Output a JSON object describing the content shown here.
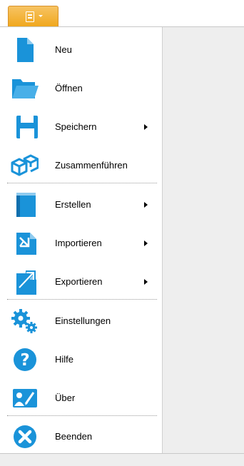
{
  "colors": {
    "accent": "#1a93d9",
    "app_button": "#f0a81d",
    "content_bg": "#eeeeee"
  },
  "menu": {
    "items": [
      {
        "label": "Neu",
        "icon": "new-document-icon",
        "submenu": false
      },
      {
        "label": "Öffnen",
        "icon": "folder-open-icon",
        "submenu": false
      },
      {
        "label": "Speichern",
        "icon": "save-icon",
        "submenu": true
      },
      {
        "label": "Zusammenführen",
        "icon": "merge-cubes-icon",
        "submenu": false
      },
      {
        "label": "Erstellen",
        "icon": "book-icon",
        "submenu": true
      },
      {
        "label": "Importieren",
        "icon": "import-icon",
        "submenu": true
      },
      {
        "label": "Exportieren",
        "icon": "export-icon",
        "submenu": true
      },
      {
        "label": "Einstellungen",
        "icon": "gears-icon",
        "submenu": false
      },
      {
        "label": "Hilfe",
        "icon": "help-icon",
        "submenu": false
      },
      {
        "label": "Über",
        "icon": "about-icon",
        "submenu": false
      },
      {
        "label": "Beenden",
        "icon": "close-icon",
        "submenu": false
      }
    ]
  }
}
